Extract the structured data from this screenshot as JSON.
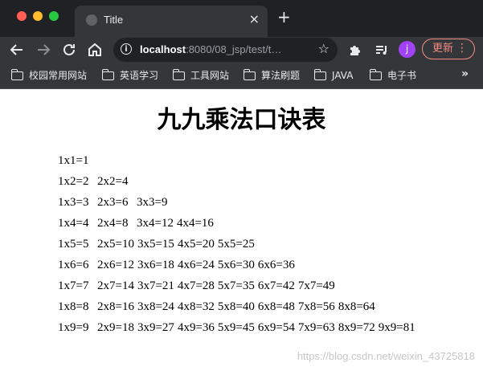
{
  "browser": {
    "tab_title": "Title",
    "tab_close": "×",
    "new_tab": "+",
    "url_host": "localhost",
    "url_path": ":8080/08_jsp/test/t…",
    "avatar_letter": "j",
    "update_label": "更新",
    "bookmarks": [
      "校园常用网站",
      "英语学习",
      "工具网站",
      "算法刷题",
      "JAVA",
      "电子书"
    ],
    "bookmarks_more": "»",
    "icons": [
      "back-arrow-icon",
      "forward-arrow-icon",
      "reload-icon",
      "home-icon",
      "info-icon",
      "star-icon",
      "extensions-puzzle-icon",
      "media-playlist-icon",
      "folder-icon",
      "more-vert-icon"
    ]
  },
  "page": {
    "title": "九九乘法口诀表",
    "rows": [
      [
        "1x1=1"
      ],
      [
        "1x2=2",
        "2x2=4"
      ],
      [
        "1x3=3",
        "2x3=6",
        "3x3=9"
      ],
      [
        "1x4=4",
        "2x4=8",
        "3x4=12",
        "4x4=16"
      ],
      [
        "1x5=5",
        "2x5=10",
        "3x5=15",
        "4x5=20",
        "5x5=25"
      ],
      [
        "1x6=6",
        "2x6=12",
        "3x6=18",
        "4x6=24",
        "5x6=30",
        "6x6=36"
      ],
      [
        "1x7=7",
        "2x7=14",
        "3x7=21",
        "4x7=28",
        "5x7=35",
        "6x7=42",
        "7x7=49"
      ],
      [
        "1x8=8",
        "2x8=16",
        "3x8=24",
        "4x8=32",
        "5x8=40",
        "6x8=48",
        "7x8=56",
        "8x8=64"
      ],
      [
        "1x9=9",
        "2x9=18",
        "3x9=27",
        "4x9=36",
        "5x9=45",
        "6x9=54",
        "7x9=63",
        "8x9=72",
        "9x9=81"
      ]
    ],
    "watermark": "https://blog.csdn.net/weixin_43725818"
  }
}
